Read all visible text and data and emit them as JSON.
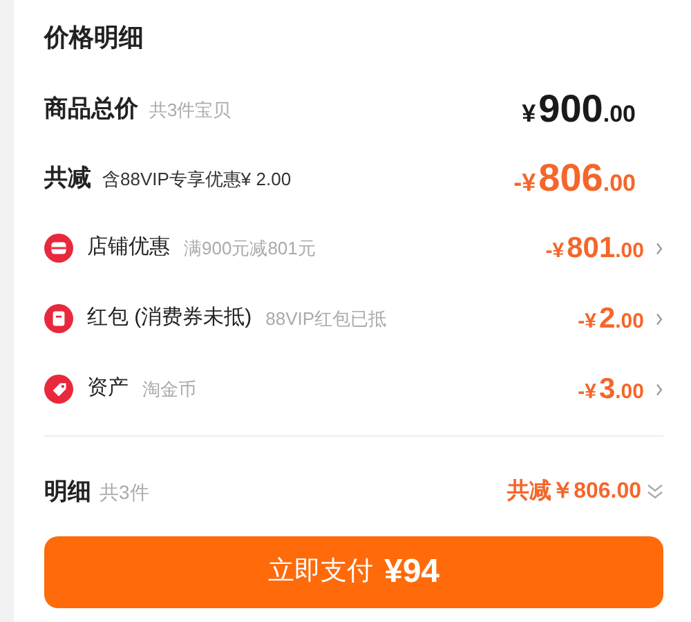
{
  "title": "价格明细",
  "total": {
    "label": "商品总价",
    "note": "共3件宝贝",
    "price": {
      "prefix": "¥",
      "integer": "900",
      "decimal": ".00"
    }
  },
  "reduction": {
    "label": "共减",
    "note": "含88VIP专享优惠¥ 2.00",
    "price": {
      "prefix": "-¥",
      "integer": "806",
      "decimal": ".00"
    }
  },
  "discounts": [
    {
      "kind": "store",
      "label": "店铺优惠",
      "note": "满900元减801元",
      "price": {
        "prefix": "-¥",
        "integer": "801",
        "decimal": ".00"
      }
    },
    {
      "kind": "redpacket",
      "label": "红包 (消费券未抵)",
      "note": "88VIP红包已抵",
      "price": {
        "prefix": "-¥",
        "integer": "2",
        "decimal": ".00"
      }
    },
    {
      "kind": "asset",
      "label": "资产",
      "note": "淘金币",
      "price": {
        "prefix": "-¥",
        "integer": "3",
        "decimal": ".00"
      }
    }
  ],
  "detail": {
    "label": "明细",
    "note": "共3件",
    "summary": "共减￥806.00",
    "expanded": false
  },
  "pay_button": {
    "label": "立即支付",
    "amount": "¥94"
  }
}
